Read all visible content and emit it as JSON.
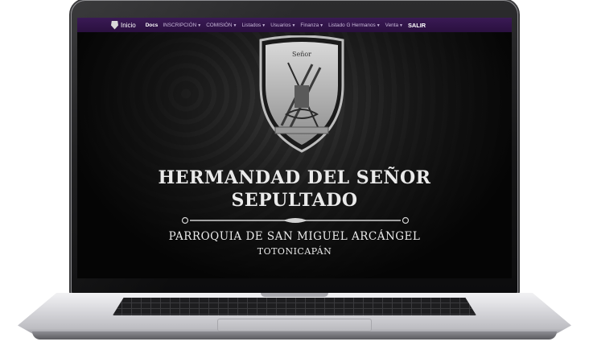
{
  "navbar": {
    "brand": "Inicio",
    "docs": "Docs",
    "menu": [
      {
        "label": "INSCRIPCIÓN"
      },
      {
        "label": "COMISIÓN"
      },
      {
        "label": "Listados"
      },
      {
        "label": "Usuarios"
      },
      {
        "label": "Finanza"
      },
      {
        "label": "Listado G Hermanos"
      },
      {
        "label": "Venta"
      }
    ],
    "exit": "SALIR"
  },
  "hero": {
    "emblem_caption": "Señor",
    "title_line1": "HERMANDAD DEL SEÑOR",
    "title_line2": "SEPULTADO",
    "subtitle": "PARROQUIA DE SAN MIGUEL ARCÁNGEL",
    "location": "TOTONICAPÁN"
  },
  "colors": {
    "navbar": "#2a103f",
    "nav_text": "#c7b7d8",
    "background": "#000000",
    "title": "#eaeaea"
  },
  "icons": {
    "brand": "shield-logo-icon",
    "dropdown": "caret-down-icon",
    "emblem": "coat-of-arms-emblem"
  }
}
